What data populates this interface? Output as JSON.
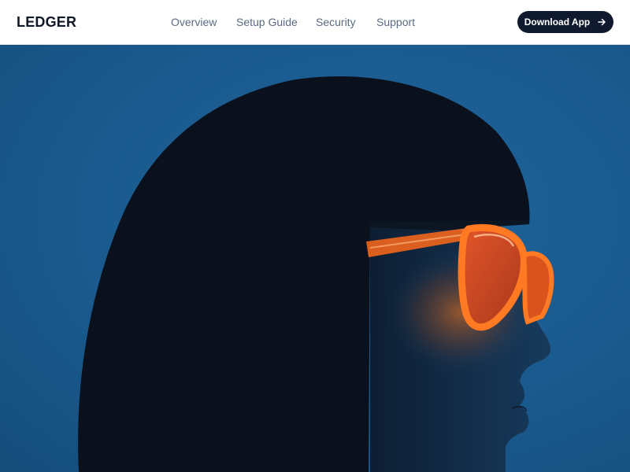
{
  "header": {
    "logo": "LEDGER",
    "nav": [
      {
        "label": "Overview"
      },
      {
        "label": "Setup Guide"
      },
      {
        "label": "Security"
      },
      {
        "label": "Support"
      }
    ],
    "cta": {
      "label": "Download App",
      "icon": "arrow-right-icon"
    }
  },
  "hero": {
    "image": "portrait-woman-black-bob-orange-sunglasses",
    "background_color": "#1a5a8e",
    "accent_color": "#ff6a1a"
  },
  "colors": {
    "header_bg": "#ffffff",
    "logo": "#111827",
    "nav_text": "#596a82",
    "cta_bg": "#0f1a2e",
    "cta_text": "#ffffff"
  }
}
